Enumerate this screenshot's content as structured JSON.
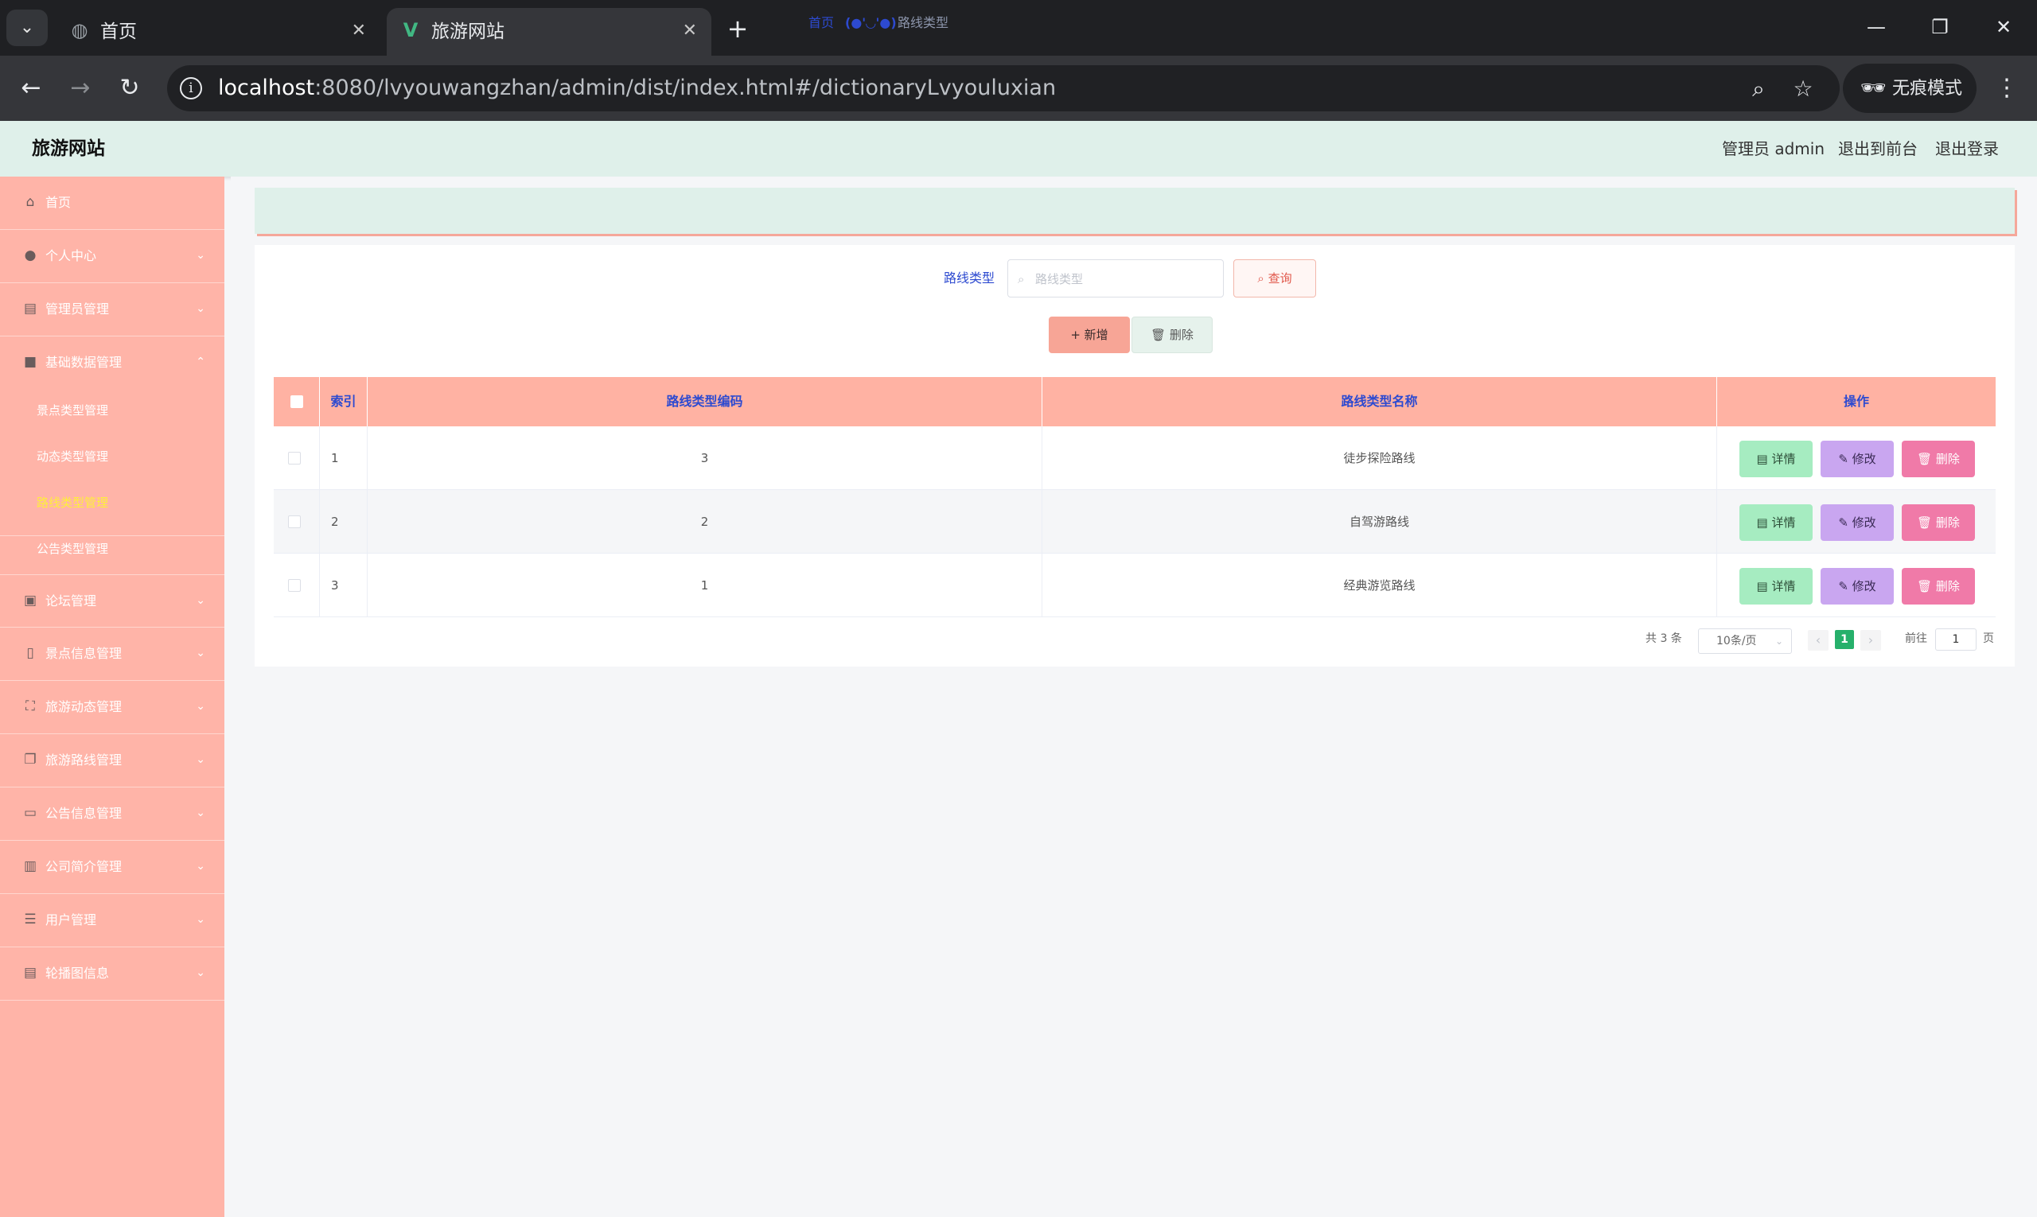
{
  "browser": {
    "tabs": [
      {
        "title": "首页",
        "icon": "globe-icon"
      },
      {
        "title": "旅游网站",
        "icon": "vue-logo-icon"
      }
    ],
    "url_host": "localhost",
    "url_path": ":8080/lvyouwangzhan/admin/dist/index.html#/dictionaryLvyouluxian",
    "incognito_label": "无痕模式"
  },
  "header": {
    "brand": "旅游网站",
    "user_label": "管理员 admin",
    "to_front": "退出到前台",
    "logout": "退出登录"
  },
  "sidebar": {
    "items": [
      {
        "label": "首页",
        "icon": "home-icon"
      },
      {
        "label": "个人中心",
        "icon": "user-icon"
      },
      {
        "label": "管理员管理",
        "icon": "clipboard-icon"
      },
      {
        "label": "基础数据管理",
        "icon": "video-icon"
      },
      {
        "label": "论坛管理",
        "icon": "picture-icon"
      },
      {
        "label": "景点信息管理",
        "icon": "phone-icon"
      },
      {
        "label": "旅游动态管理",
        "icon": "fullscreen-icon"
      },
      {
        "label": "旅游路线管理",
        "icon": "copy-icon"
      },
      {
        "label": "公告信息管理",
        "icon": "chat-icon"
      },
      {
        "label": "公司简介管理",
        "icon": "books-icon"
      },
      {
        "label": "用户管理",
        "icon": "sliders-icon"
      },
      {
        "label": "轮播图信息",
        "icon": "clipboard-icon"
      }
    ],
    "sub_items": [
      {
        "label": "景点类型管理"
      },
      {
        "label": "动态类型管理"
      },
      {
        "label": "路线类型管理"
      },
      {
        "label": "公告类型管理"
      }
    ]
  },
  "breadcrumb": {
    "home": "首页",
    "separator": "(●'◡'●)",
    "current": "路线类型"
  },
  "search": {
    "label": "路线类型",
    "placeholder": "路线类型",
    "value": "",
    "query_button": "查询"
  },
  "toolbar": {
    "add_button": "新增",
    "delete_button": "删除"
  },
  "table": {
    "columns": [
      "索引",
      "路线类型编码",
      "路线类型名称",
      "操作"
    ],
    "rows": [
      {
        "index": "1",
        "code": "3",
        "name": "徒步探险路线"
      },
      {
        "index": "2",
        "code": "2",
        "name": "自驾游路线"
      },
      {
        "index": "3",
        "code": "1",
        "name": "经典游览路线"
      }
    ],
    "actions": {
      "detail": "详情",
      "edit": "修改",
      "delete": "删除"
    }
  },
  "pagination": {
    "total": "共 3 条",
    "page_size": "10条/页",
    "current_page": "1",
    "goto_label": "前往",
    "goto_value": "1",
    "page_suffix": "页"
  },
  "colors": {
    "sidebar_bg": "#ffb4a8",
    "header_bg": "#dff0ea",
    "accent_text": "#2d4ad0",
    "active_submenu": "#ffef3a",
    "pager_active": "#26b06b"
  }
}
